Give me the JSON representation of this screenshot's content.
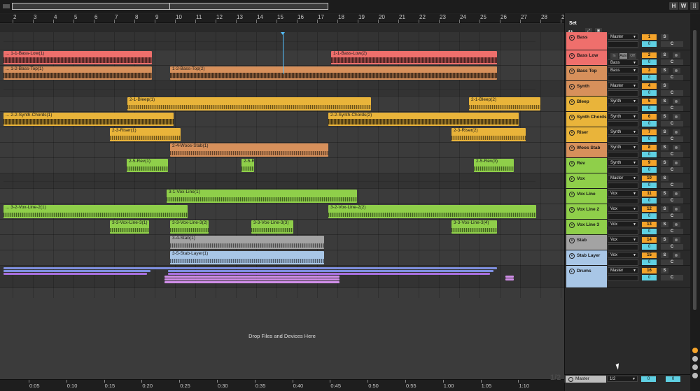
{
  "topbar": {
    "btn_h": "H",
    "btn_w": "W"
  },
  "ruler": {
    "bars": [
      "2",
      "3",
      "4",
      "5",
      "6",
      "7",
      "8",
      "9",
      "10",
      "11",
      "12",
      "13",
      "14",
      "15",
      "16",
      "17",
      "18",
      "19",
      "20",
      "21",
      "22",
      "23",
      "24",
      "25",
      "26",
      "27",
      "28",
      "29"
    ]
  },
  "mixer": {
    "set_label": "Set"
  },
  "tracks": [
    {
      "name": "Bass",
      "color": "#ef6f6c",
      "output": "Master",
      "num": "1",
      "vol": "0",
      "group": true
    },
    {
      "name": "Bass Low",
      "color": "#ef6f6c",
      "output": "Bass",
      "num": "2",
      "vol": "0",
      "monitor": [
        "In",
        "Auto",
        "Off"
      ]
    },
    {
      "name": "Bass Top",
      "color": "#d7905b",
      "output": "Bass",
      "num": "3",
      "vol": "0"
    },
    {
      "name": "Synth",
      "color": "#d7905b",
      "output": "Master",
      "num": "4",
      "vol": "0",
      "group": true
    },
    {
      "name": "Bleep",
      "color": "#e9b43a",
      "output": "Synth",
      "num": "5",
      "vol": "0"
    },
    {
      "name": "Synth Chords",
      "color": "#e9b43a",
      "output": "Synth",
      "num": "6",
      "vol": "0"
    },
    {
      "name": "Riser",
      "color": "#e9b43a",
      "output": "Synth",
      "num": "7",
      "vol": "0"
    },
    {
      "name": "Woos Stab",
      "color": "#d7905b",
      "output": "Synth",
      "num": "8",
      "vol": "0"
    },
    {
      "name": "Rev",
      "color": "#8fcf4a",
      "output": "Synth",
      "num": "9",
      "vol": "0"
    },
    {
      "name": "Vox",
      "color": "#8fcf4a",
      "output": "Master",
      "num": "10",
      "vol": "0",
      "group": true
    },
    {
      "name": "Vox Line",
      "color": "#8fcf4a",
      "output": "Vox",
      "num": "11",
      "vol": "0"
    },
    {
      "name": "Vox Line 2",
      "color": "#8fcf4a",
      "output": "Vox",
      "num": "12",
      "vol": "0"
    },
    {
      "name": "Vox Line 3",
      "color": "#8fcf4a",
      "output": "Vox",
      "num": "13",
      "vol": "0"
    },
    {
      "name": "Stab",
      "color": "#a3a3a3",
      "output": "Vox",
      "num": "14",
      "vol": "0"
    },
    {
      "name": "Stab Layer",
      "color": "#a8c6e6",
      "output": "Vox",
      "num": "15",
      "vol": "0"
    },
    {
      "name": "Drums",
      "color": "#a8c6e6",
      "output": "Master",
      "num": "16",
      "vol": "0",
      "group": true
    }
  ],
  "clips": [
    {
      "label": "... 1-1-Bass-Low(1)",
      "row": 1,
      "start": 5,
      "end": 217,
      "color": "#ef6f6c"
    },
    {
      "label": "1-1-Bass-Low(2)",
      "row": 1,
      "start": 473,
      "end": 710,
      "color": "#ef6f6c"
    },
    {
      "label": "... 1-2-Bass-Top(1)",
      "row": 2,
      "start": 5,
      "end": 217,
      "color": "#d7905b"
    },
    {
      "label": "1-2-Bass-Top(2)",
      "row": 2,
      "start": 243,
      "end": 710,
      "color": "#d7905b"
    },
    {
      "label": "2-1-Bleep(1)",
      "row": 4,
      "start": 182,
      "end": 530,
      "color": "#e9b43a"
    },
    {
      "label": "2-1-Bleep(2)",
      "row": 4,
      "start": 670,
      "end": 772,
      "color": "#e9b43a"
    },
    {
      "label": "... 2-2-Synth-Chords(1)",
      "row": 5,
      "start": 5,
      "end": 248,
      "color": "#e9b43a"
    },
    {
      "label": "2-2-Synth-Chords(2)",
      "row": 5,
      "start": 469,
      "end": 741,
      "color": "#e9b43a"
    },
    {
      "label": "2-3-Riser(1)",
      "row": 6,
      "start": 157,
      "end": 258,
      "color": "#e9b43a"
    },
    {
      "label": "2-3-Riser(2)",
      "row": 6,
      "start": 645,
      "end": 751,
      "color": "#e9b43a"
    },
    {
      "label": "2-4-Woos-Stab(1)",
      "row": 7,
      "start": 243,
      "end": 469,
      "color": "#d7905b"
    },
    {
      "label": "2-5-Rev(1)",
      "row": 8,
      "start": 181,
      "end": 240,
      "color": "#8fcf4a"
    },
    {
      "label": "2-5-R",
      "row": 8,
      "start": 345,
      "end": 363,
      "color": "#8fcf4a"
    },
    {
      "label": "2-5-Rev(3)",
      "row": 8,
      "start": 677,
      "end": 734,
      "color": "#8fcf4a"
    },
    {
      "label": "3-1-Vox-Line(1)",
      "row": 10,
      "start": 238,
      "end": 510,
      "color": "#8fcf4a"
    },
    {
      "label": "... 3-2-Vox-Line-2(1)",
      "row": 11,
      "start": 5,
      "end": 268,
      "color": "#8fcf4a"
    },
    {
      "label": "3-2-Vox-Line-2(2)",
      "row": 11,
      "start": 469,
      "end": 766,
      "color": "#8fcf4a"
    },
    {
      "label": "3-3-Vox-Line-3(1)",
      "row": 12,
      "start": 157,
      "end": 213,
      "color": "#8fcf4a"
    },
    {
      "label": "3-3-Vox-Line-3(2)",
      "row": 12,
      "start": 243,
      "end": 298,
      "color": "#8fcf4a"
    },
    {
      "label": "3-3-Vox-Line-3(3)",
      "row": 12,
      "start": 359,
      "end": 419,
      "color": "#8fcf4a"
    },
    {
      "label": "3-3-Vox-Line-3(4)",
      "row": 12,
      "start": 645,
      "end": 710,
      "color": "#8fcf4a"
    },
    {
      "label": "3-4-Stab(1)",
      "row": 13,
      "start": 243,
      "end": 463,
      "color": "#a3a3a3"
    },
    {
      "label": "3-5-Stab-Layer(1)",
      "row": 14,
      "start": 243,
      "end": 463,
      "color": "#a8c6e6"
    }
  ],
  "drop_zone": {
    "text": "Drop Files and Devices Here"
  },
  "time_ruler": {
    "labels": [
      "0:05",
      "0:10",
      "0:15",
      "0:20",
      "0:25",
      "0:30",
      "0:35",
      "0:40",
      "0:45",
      "0:50",
      "0:55",
      "1:00",
      "1:05",
      "1:10"
    ]
  },
  "master": {
    "name": "Master",
    "output": "1/2",
    "vol_left": "0",
    "vol_right": "0"
  },
  "overlay": {
    "fraction": "1/2"
  },
  "labels": {
    "solo": "S",
    "cue": "C"
  }
}
